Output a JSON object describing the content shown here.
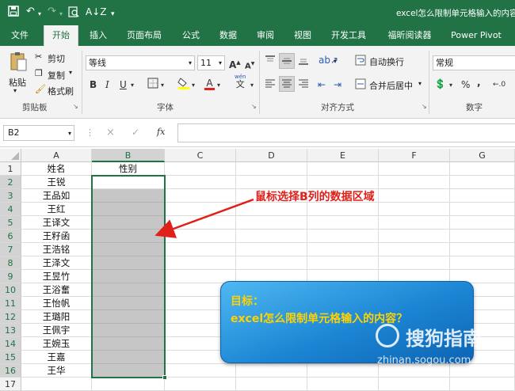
{
  "titlebar": {
    "title": "excel怎么限制单元格输入的内容",
    "save_icon": "save-icon",
    "undo_icon": "undo-icon",
    "redo_icon": "redo-icon",
    "print_preview_icon": "print-preview-icon",
    "sort_icon": "sort-icon",
    "customize_icon": "customize-icon",
    "bg_color": "#217346"
  },
  "tabs": [
    "文件",
    "开始",
    "插入",
    "页面布局",
    "公式",
    "数据",
    "审阅",
    "视图",
    "开发工具",
    "福昕阅读器",
    "Power Pivot"
  ],
  "ribbon": {
    "clipboard": {
      "paste": "粘贴",
      "cut": "剪切",
      "copy": "复制",
      "format_painter": "格式刷",
      "group": "剪贴板"
    },
    "font": {
      "name": "等线",
      "size": "11",
      "bold": "B",
      "italic": "I",
      "underline": "U",
      "grow": "A",
      "shrink": "A",
      "wen": "wén",
      "font_color_letter": "A",
      "group": "字体"
    },
    "alignment": {
      "wrap": "自动换行",
      "merge": "合并后居中",
      "group": "对齐方式"
    },
    "number": {
      "format": "常规",
      "percent": "%",
      "comma": ",",
      "group": "数字"
    }
  },
  "formula_bar": {
    "name_box": "B2",
    "fx": "fx",
    "cancel": "×",
    "enter": "✓",
    "content": ""
  },
  "columns": [
    "A",
    "B",
    "C",
    "D",
    "E",
    "F",
    "G"
  ],
  "rows": [
    "1",
    "2",
    "3",
    "4",
    "5",
    "6",
    "7",
    "8",
    "9",
    "10",
    "11",
    "12",
    "13",
    "14",
    "15",
    "16",
    "17"
  ],
  "cells": {
    "col_a": [
      "姓名",
      "王锐",
      "王品如",
      "王红",
      "王译文",
      "王籽函",
      "王浩铭",
      "王泽文",
      "王昱竹",
      "王浴奮",
      "王怡帆",
      "王璐阳",
      "王佩宇",
      "王婉玉",
      "王嘉",
      "王华",
      ""
    ],
    "col_b_header": "性别"
  },
  "annotation": {
    "text": "鼠标选择B列的数据区域",
    "color": "#e0201a"
  },
  "callout": {
    "line1": "目标：",
    "line2": "excel怎么限制单元格输入的内容？",
    "text_color": "#ffd200"
  },
  "watermark": {
    "brand": "搜狗指南",
    "url": "zhinan.sogou.com"
  }
}
